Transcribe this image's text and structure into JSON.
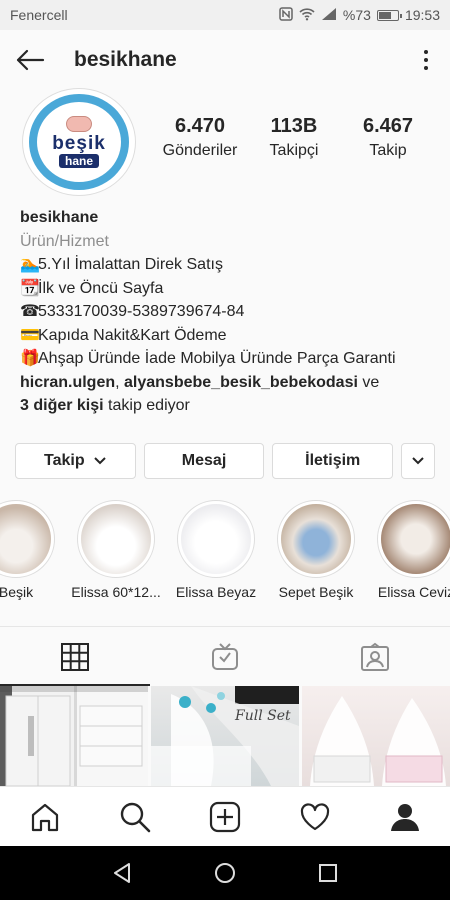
{
  "status_bar": {
    "carrier": "Fenercell",
    "battery": "%73",
    "time": "19:53",
    "battery_level": 0.73
  },
  "header": {
    "username": "besikhane"
  },
  "avatar": {
    "logo_line1": "beşik",
    "logo_line2": "hane"
  },
  "stats": [
    {
      "value": "6.470",
      "label": "Gönderiler"
    },
    {
      "value": "113B",
      "label": "Takipçi"
    },
    {
      "value": "6.467",
      "label": "Takip"
    }
  ],
  "bio": {
    "name": "besikhane",
    "category": "Ürün/Hizmet",
    "lines": [
      {
        "emoji": "🏊",
        "text": "5.Yıl İmalattan Direk Satış"
      },
      {
        "emoji": "📆",
        "text": "İlk ve Öncü Sayfa"
      },
      {
        "emoji": "☎",
        "text": "5333170039-5389739674-84"
      },
      {
        "emoji": "💳",
        "text": "Kapıda Nakit&Kart Ödeme"
      },
      {
        "emoji": "🎁",
        "text": "Ahşap Üründe İade Mobilya Üründe Parça Garanti"
      }
    ],
    "followed_by_1": "hicran.ulgen",
    "followed_sep": ", ",
    "followed_by_2": "alyansbebe_besik_bebekodasi",
    "followed_and": " ve",
    "followed_others": "3 diğer kişi",
    "followed_suffix": " takip ediyor"
  },
  "actions": {
    "follow": "Takip",
    "message": "Mesaj",
    "contact": "İletişim"
  },
  "highlights": [
    {
      "label": "Beşik",
      "color": "#c9b7a8"
    },
    {
      "label": "Elissa 60*12...",
      "color": "#d8cfc8"
    },
    {
      "label": "Elissa Beyaz",
      "color": "#e6e6ea"
    },
    {
      "label": "Sepet Beşik",
      "color": "#b9a48f"
    },
    {
      "label": "Elissa Ceviz",
      "color": "#9c7d68"
    }
  ],
  "grid": [
    {
      "color": "#c8c8c8"
    },
    {
      "color": "#dcdcdc",
      "overlay_text": "Full Set"
    },
    {
      "color": "#e8dedd"
    }
  ],
  "icons": {
    "back": "back-arrow-icon",
    "more": "more-vertical-icon",
    "tab_grid": "grid-icon",
    "tab_igtv": "igtv-icon",
    "tab_tagged": "tagged-icon",
    "nav_home": "home-icon",
    "nav_search": "search-icon",
    "nav_add": "add-post-icon",
    "nav_activity": "heart-icon",
    "nav_profile": "profile-icon"
  }
}
